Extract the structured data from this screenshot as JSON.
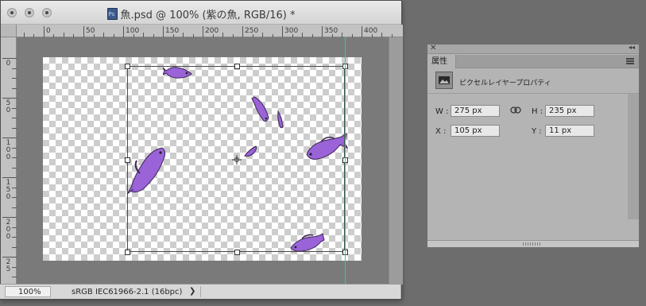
{
  "window": {
    "title": "魚.psd @ 100% (紫の魚, RGB/16) *"
  },
  "ruler": {
    "h_labels": [
      "0",
      "50",
      "100",
      "150",
      "200",
      "250",
      "300",
      "350",
      "400"
    ],
    "v_labels": [
      "0",
      "50",
      "100",
      "150",
      "200",
      "25"
    ]
  },
  "status": {
    "zoom": "100%",
    "profile": "sRGB IEC61966-2.1 (16bpc)",
    "arrow": "❯"
  },
  "properties": {
    "tab": "属性",
    "layer_type": "ピクセルレイヤープロパティ",
    "w_label": "W :",
    "w_value": "275 px",
    "h_label": "H :",
    "h_value": "235 px",
    "x_label": "X :",
    "x_value": "105 px",
    "y_label": "Y :",
    "y_value": "11 px"
  },
  "colors": {
    "guide": "#18d6b4",
    "fish": "#9a63d8"
  }
}
